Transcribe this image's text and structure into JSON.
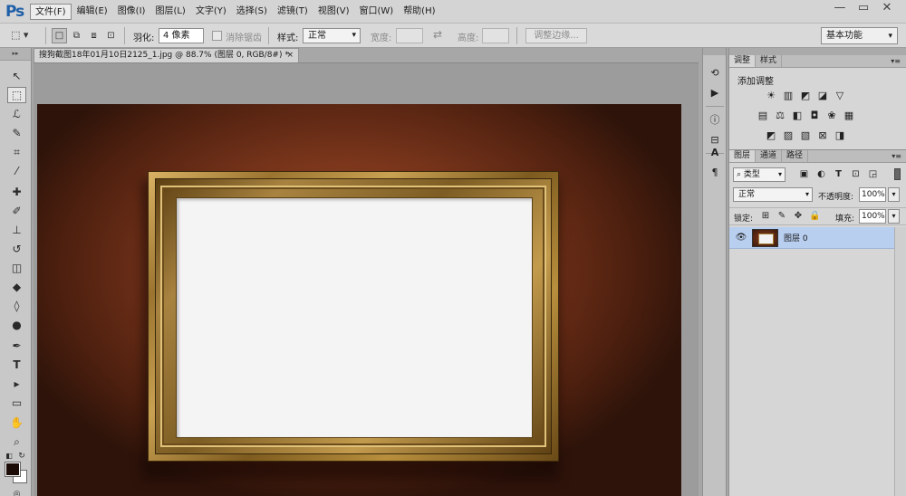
{
  "app": {
    "logo": "Ps"
  },
  "menu": [
    {
      "label": "文件(F)"
    },
    {
      "label": "编辑(E)"
    },
    {
      "label": "图像(I)"
    },
    {
      "label": "图层(L)"
    },
    {
      "label": "文字(Y)"
    },
    {
      "label": "选择(S)"
    },
    {
      "label": "滤镜(T)"
    },
    {
      "label": "视图(V)"
    },
    {
      "label": "窗口(W)"
    },
    {
      "label": "帮助(H)"
    }
  ],
  "window_controls": {
    "minimize": "—",
    "restore": "▭",
    "close": "✕"
  },
  "options": {
    "feather_label": "羽化:",
    "feather_value": "4 像素",
    "antialias_label": "消除锯齿",
    "style_label": "样式:",
    "style_value": "正常",
    "width_label": "宽度:",
    "height_label": "高度:",
    "swap_icon": "⇄",
    "refine_label": "调整边缘...",
    "workspace": "基本功能"
  },
  "document": {
    "tab_title": "搜狗截图18年01月10日2125_1.jpg @ 88.7% (图层 0, RGB/8#) *",
    "close": "×"
  },
  "panels": {
    "adjust_tabs": [
      "调整",
      "样式"
    ],
    "adjust_title": "添加调整",
    "layer_tabs": [
      "图层",
      "通道",
      "路径"
    ],
    "filter_kind": "类型",
    "blend_mode": "正常",
    "opacity_label": "不透明度:",
    "opacity_value": "100%",
    "lock_label": "锁定:",
    "fill_label": "填充:",
    "fill_value": "100%",
    "layers": [
      {
        "name": "图层 0",
        "visible": true
      }
    ]
  },
  "colors": {
    "foreground": "#1c0c08",
    "background": "#ffffff",
    "selected_layer": "#b9cff0"
  }
}
